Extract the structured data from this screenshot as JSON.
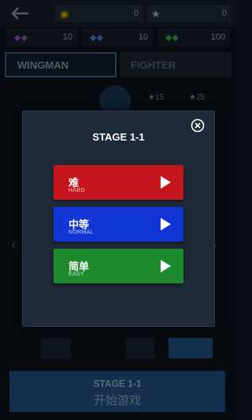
{
  "topbar": {
    "back_icon": "back-arrow-icon",
    "coins": "0",
    "stars": "0",
    "resource_purple": "10",
    "resource_blue": "10",
    "resource_green": "100"
  },
  "tabs": {
    "wingman": "WINGMAN",
    "fighter": "FIGHTER"
  },
  "costs": {
    "cost_a": "★15",
    "cost_b": "★25"
  },
  "start": {
    "stage": "STAGE 1-1",
    "label": "开始游戏"
  },
  "modal": {
    "title": "STAGE 1-1",
    "close_icon": "close-icon",
    "difficulties": [
      {
        "cn": "难",
        "en": "HARD",
        "color": "#c4161c"
      },
      {
        "cn": "中等",
        "en": "NORMAL",
        "color": "#1235d6"
      },
      {
        "cn": "简单",
        "en": "EASY",
        "color": "#1e8a2e"
      }
    ]
  }
}
